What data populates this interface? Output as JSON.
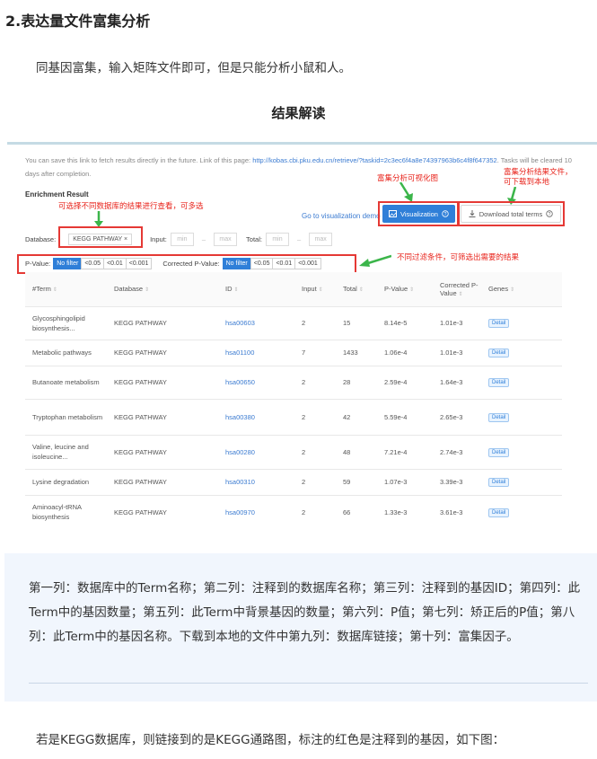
{
  "article": {
    "heading": "2.表达量文件富集分析",
    "intro": "同基因富集，输入矩阵文件即可，但是只能分析小鼠和人。",
    "result_title": "结果解读",
    "explanation": "第一列：数据库中的Term名称；第二列：注释到的数据库名称；第三列：注释到的基因ID；第四列：此Term中的基因数量；第五列：此Term中背景基因的数量；第六列：P值；第七列：矫正后的P值；第八列：此Term中的基因名称。下载到本地的文件中第九列：数据库链接；第十列：富集因子。",
    "outro": "若是KEGG数据库，则链接到的是KEGG通路图，标注的红色是注释到的基因，如下图："
  },
  "screenshot": {
    "note_text": "You can save this link to fetch results directly in the future. Link of this page:",
    "note_link": "http://kobas.cbi.pku.edu.cn/retrieve/?taskid=2c3ec6f4a8e74397963b6c4f8f647352",
    "note_tail": ". Tasks will be cleared 10 days after completion.",
    "enrichment_label": "Enrichment Result",
    "viz_demo_link": "Go to visualization demo",
    "viz_button": "Visualization",
    "download_button": "Download total terms",
    "database_label": "Database:",
    "database_tag": "KEGG PATHWAY",
    "database_tag_close": "×",
    "input_label": "Input:",
    "total_label": "Total:",
    "min_placeholder": "min",
    "max_placeholder": "max",
    "range_dash": "–",
    "pvalue_label": "P-Value:",
    "corrected_label": "Corrected P-Value:",
    "filter_options": [
      "No filter",
      "<0.05",
      "<0.01",
      "<0.001"
    ],
    "annotations": {
      "database_note": "可选择不同数据库的结果进行查看，可多选",
      "viz_note": "富集分析可视化图",
      "download_note_1": "富集分析结果文件，",
      "download_note_2": "可下载到本地",
      "filter_note": "不同过滤条件，可筛选出需要的结果"
    },
    "table": {
      "columns": [
        "#Term",
        "Database",
        "ID",
        "Input",
        "Total",
        "P-Value",
        "Corrected P-Value",
        "Genes"
      ],
      "detail_label": "Detail",
      "rows": [
        {
          "term": "Glycosphingolipid biosynthesis...",
          "db": "KEGG PATHWAY",
          "id": "hsa00603",
          "input": "2",
          "total": "15",
          "p": "8.14e-5",
          "cp": "1.01e-3"
        },
        {
          "term": "Metabolic pathways",
          "db": "KEGG PATHWAY",
          "id": "hsa01100",
          "input": "7",
          "total": "1433",
          "p": "1.06e-4",
          "cp": "1.01e-3"
        },
        {
          "term": "Butanoate metabolism",
          "db": "KEGG PATHWAY",
          "id": "hsa00650",
          "input": "2",
          "total": "28",
          "p": "2.59e-4",
          "cp": "1.64e-3"
        },
        {
          "term": "Tryptophan metabolism",
          "db": "KEGG PATHWAY",
          "id": "hsa00380",
          "input": "2",
          "total": "42",
          "p": "5.59e-4",
          "cp": "2.65e-3"
        },
        {
          "term": "Valine, leucine and isoleucine...",
          "db": "KEGG PATHWAY",
          "id": "hsa00280",
          "input": "2",
          "total": "48",
          "p": "7.21e-4",
          "cp": "2.74e-3"
        },
        {
          "term": "Lysine degradation",
          "db": "KEGG PATHWAY",
          "id": "hsa00310",
          "input": "2",
          "total": "59",
          "p": "1.07e-3",
          "cp": "3.39e-3"
        },
        {
          "term": "Aminoacyl-tRNA biosynthesis",
          "db": "KEGG PATHWAY",
          "id": "hsa00970",
          "input": "2",
          "total": "66",
          "p": "1.33e-3",
          "cp": "3.61e-3"
        }
      ]
    },
    "colors": {
      "accent_blue": "#2f7fd8",
      "annotation_red": "#e8231b",
      "arrow_green": "#3bb54a",
      "explain_bg": "#f1f6fd"
    }
  }
}
